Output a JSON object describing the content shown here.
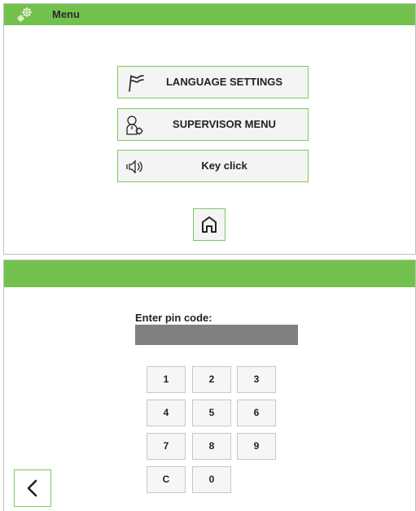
{
  "menu_screen": {
    "title": "Menu",
    "title_icon": "gears-icon",
    "items": [
      {
        "label": "LANGUAGE SETTINGS",
        "icon": "flag-icon"
      },
      {
        "label": "SUPERVISOR MENU",
        "icon": "supervisor-icon"
      },
      {
        "label": "Key click",
        "icon": "speaker-icon"
      }
    ],
    "home_icon": "home-icon"
  },
  "pin_screen": {
    "prompt": "Enter pin code:",
    "pin_value": "",
    "keys": [
      "1",
      "2",
      "3",
      "4",
      "5",
      "6",
      "7",
      "8",
      "9",
      "C",
      "0"
    ],
    "back_icon": "chevron-left-icon"
  },
  "colors": {
    "header_green": "#72c14c",
    "button_border": "#7cc95a",
    "pin_field": "#808080"
  }
}
